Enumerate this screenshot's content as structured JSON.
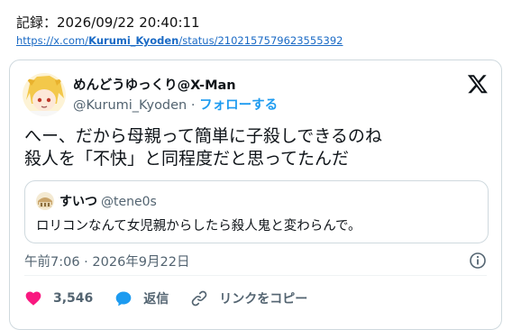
{
  "record": {
    "label": "記録：2026/09/22 20:40:11"
  },
  "url": {
    "prefix": "https://x.com/",
    "user": "Kurumi_Kyoden",
    "suffix": "/status/2102157579623555392"
  },
  "author": {
    "name": "めんどうゆっくり@X-Man",
    "handle": "@Kurumi_Kyoden",
    "separator": "·",
    "follow_label": "フォローする"
  },
  "icons": {
    "logo": "x-logo-icon",
    "info": "info-icon",
    "like": "heart-icon",
    "reply": "reply-bubble-icon",
    "copy_link": "link-icon"
  },
  "tweet": {
    "line1": "へー、だから母親って簡単に子殺しできるのね",
    "line2": "殺人を「不快」と同程度だと思ってたんだ"
  },
  "quote": {
    "name": "すいつ",
    "handle": "@tene0s",
    "text": "ロリコンなんて女児親からしたら殺人鬼と変わらんで。"
  },
  "timestamp": "午前7:06 · 2026年9月22日",
  "actions": {
    "likes": "3,546",
    "reply_label": "返信",
    "copy_link_label": "リンクをコピー"
  },
  "colors": {
    "like": "#f91880",
    "reply": "#1d9bf0",
    "follow": "#1d9bf0",
    "url": "#1a6ac5"
  }
}
